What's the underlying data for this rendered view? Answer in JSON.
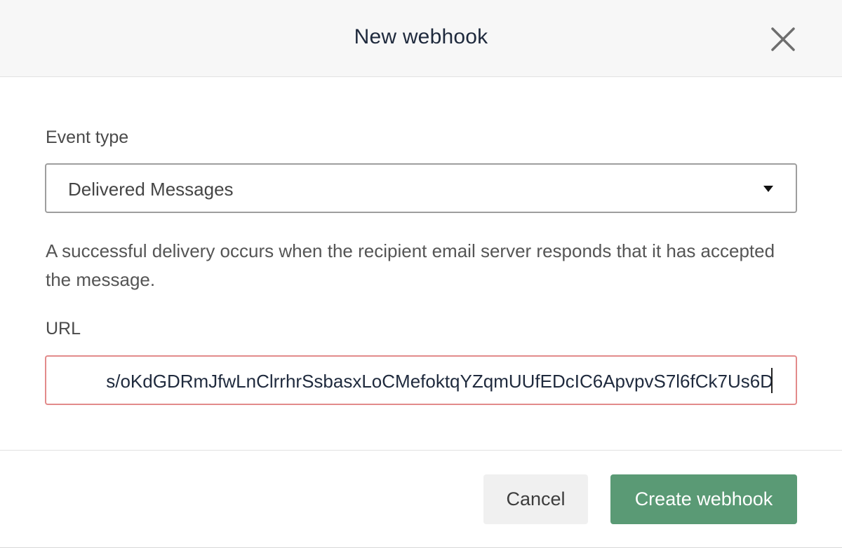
{
  "dialog": {
    "title": "New webhook",
    "close_icon": "close-icon"
  },
  "form": {
    "event_type_label": "Event type",
    "event_type_value": "Delivered Messages",
    "event_type_caret_icon": "caret-down-icon",
    "description": "A successful delivery occurs when the recipient email server responds that it has accepted the message.",
    "url_label": "URL",
    "url_value": "s/oKdGDRmJfwLnClrrhrSsbasxLoCMefoktqYZqmUUfEDcIC6ApvpvS7l6fCk7Us6D"
  },
  "footer": {
    "cancel_label": "Cancel",
    "create_label": "Create webhook"
  },
  "colors": {
    "primary": "#5a9a75",
    "error_border": "#e28b8b",
    "header_bg": "#f7f7f7"
  }
}
